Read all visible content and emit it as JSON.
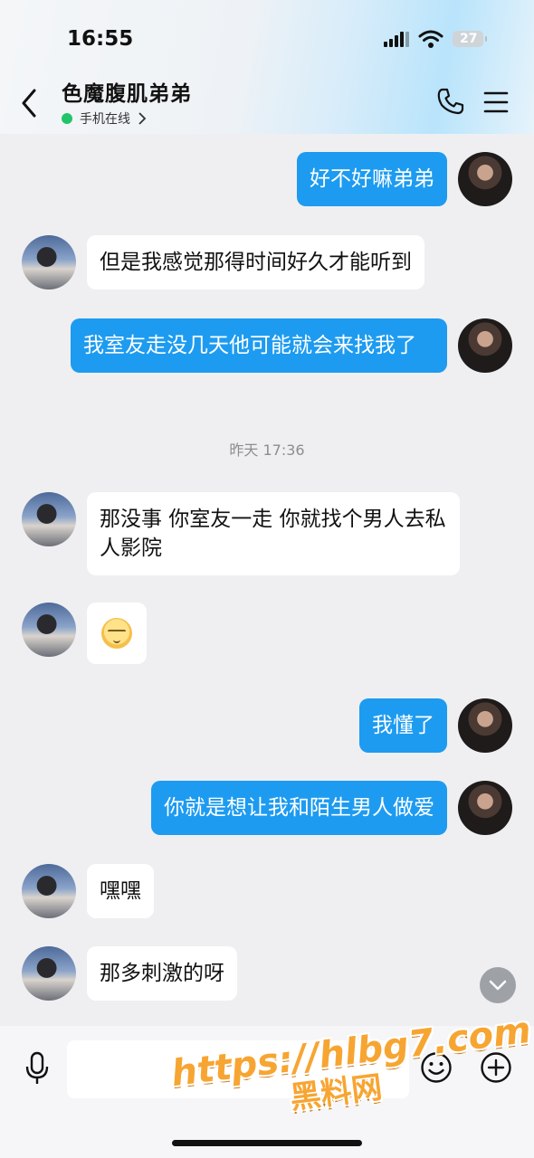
{
  "status_bar": {
    "time": "16:55",
    "battery": "27"
  },
  "header": {
    "title": "色魔腹肌弟弟",
    "status": "手机在线"
  },
  "messages": [
    {
      "side": "out",
      "text": "好不好嘛弟弟"
    },
    {
      "side": "in",
      "text": "但是我感觉那得时间好久才能听到"
    },
    {
      "side": "out",
      "text": "我室友走没几天他可能就会来找我了"
    },
    {
      "side": "timestamp",
      "text": "昨天 17:36"
    },
    {
      "side": "in",
      "text": "那没事 你室友一走 你就找个男人去私人影院"
    },
    {
      "side": "in",
      "emoji": "relieved-face"
    },
    {
      "side": "out",
      "text": "我懂了"
    },
    {
      "side": "out",
      "text": "你就是想让我和陌生男人做爱"
    },
    {
      "side": "in",
      "text": "嘿嘿"
    },
    {
      "side": "in",
      "text": "那多刺激的呀"
    }
  ],
  "input": {
    "value": ""
  },
  "watermark": {
    "url": "https://hlbg7.com",
    "label": "黑料网"
  },
  "colors": {
    "outgoing_bubble": "#1d9bf0",
    "incoming_bubble": "#ffffff",
    "online_dot": "#22c46a"
  }
}
